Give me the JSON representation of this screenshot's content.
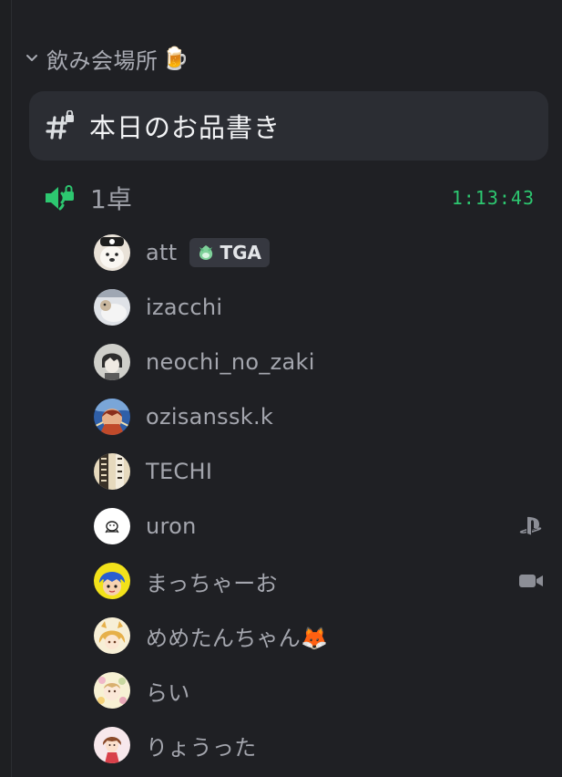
{
  "category": {
    "name": "飲み会場所",
    "emoji": "🍺",
    "icon": "chevron-down-icon"
  },
  "text_channel": {
    "name": "本日のお品書き",
    "icon": "hash-lock-icon"
  },
  "voice_channel": {
    "name": "1卓",
    "elapsed": "1:13:43",
    "icon": "speaker-lock-icon",
    "accent_color": "#2dc770"
  },
  "users": [
    {
      "name": "att",
      "tag": "TGA",
      "tag_icon": "leaf-badge-icon",
      "avatar_colors": [
        "#e8e0d8",
        "#ffffff"
      ]
    },
    {
      "name": "izacchi",
      "avatar_colors": [
        "#c8ccd4",
        "#f0f0f0"
      ]
    },
    {
      "name": "neochi_no_zaki",
      "avatar_colors": [
        "#bdbdb8",
        "#e9e9e4"
      ]
    },
    {
      "name": "ozisanssk.k",
      "avatar_colors": [
        "#c04a2a",
        "#2f5fa8"
      ]
    },
    {
      "name": "TECHI",
      "avatar_colors": [
        "#d9c9a8",
        "#3a3228"
      ]
    },
    {
      "name": "uron",
      "avatar_colors": [
        "#ffffff",
        "#ffffff"
      ],
      "status_icon": "playstation-icon"
    },
    {
      "name": "まっちゃーお",
      "avatar_colors": [
        "#f2e21a",
        "#2a5fd0"
      ],
      "status_icon": "video-camera-icon"
    },
    {
      "name": "めめたんちゃん",
      "emoji": "🦊",
      "avatar_colors": [
        "#f4e3a4",
        "#e0a040"
      ]
    },
    {
      "name": "らい",
      "avatar_colors": [
        "#f5eecb",
        "#d0a8c8"
      ]
    },
    {
      "name": "りょうった",
      "avatar_colors": [
        "#f7e8ec",
        "#d8404a"
      ]
    }
  ]
}
